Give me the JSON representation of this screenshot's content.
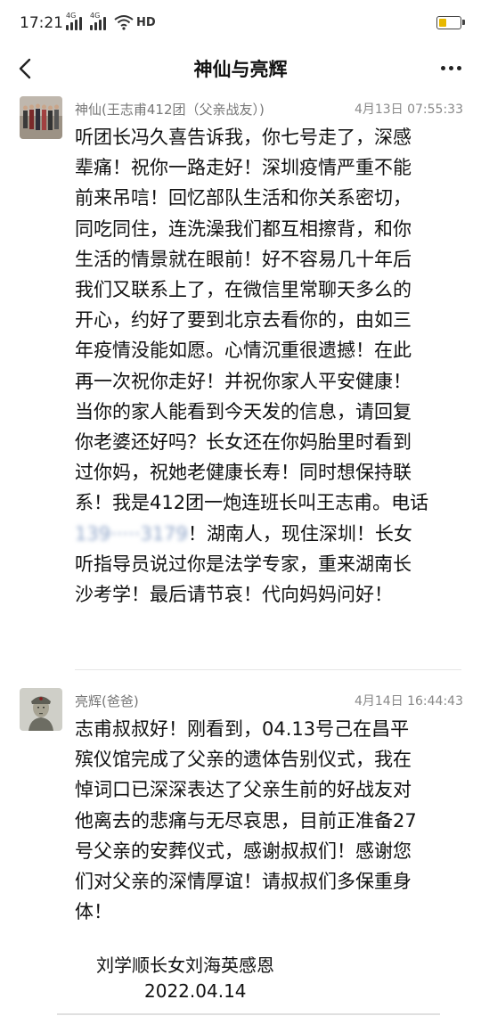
{
  "status": {
    "time": "17:21",
    "net1": "4G",
    "net2": "4G",
    "hd": "HD",
    "battery_level": 0.35
  },
  "nav": {
    "title": "神仙与亮辉"
  },
  "messages": [
    {
      "sender": "神仙(王志甫412团（父亲战友）)",
      "time": "4月13日 07:55:33",
      "lines": [
        "听团长冯久喜告诉我，你七号走了，深感",
        "辈痛！祝你一路走好！深圳疫情严重不能",
        "前来吊唁！回忆部队生活和你关系密切，",
        "同吃同住，连洗澡我们都互相擦背，和你",
        "生活的情景就在眼前！好不容易几十年后",
        "我们又联系上了，在微信里常聊天多么的",
        "开心，约好了要到北京去看你的，由如三",
        "年疫情没能如愿。心情沉重很遗撼！在此",
        "再一次祝你走好！并祝你家人平安健康！",
        "当你的家人能看到今天发的信息，请回复",
        "你老婆还好吗？长女还在你妈胎里时看到",
        "过你妈，祝她老健康长寿！同时想保持联",
        "系！我是412团一炮连班长叫王志甫。电话"
      ],
      "phone_masked": "139·····3179",
      "line14_rest": "！湖南人，现住深圳！长女",
      "lines_after": [
        "听指导员说过你是法学专家，重来湖南长",
        "沙考学！最后请节哀！代向妈妈问好！"
      ]
    },
    {
      "sender": "亮辉(爸爸)",
      "time": "4月14日 16:44:43",
      "lines": [
        "志甫叔叔好！刚看到，04.13号己在昌平",
        "殡仪馆完成了父亲的遗体告别仪式，我在",
        "悼词口已深深表达了父亲生前的好战友对",
        "他离去的悲痛与无尽哀思，目前正准备27",
        "号父亲的安葬仪式，感谢叔叔们！感谢您",
        "们对父亲的深情厚谊！请叔叔们多保重身",
        "体！"
      ],
      "signature": "刘学顺长女刘海英感恩",
      "date": "2022.04.14"
    }
  ]
}
